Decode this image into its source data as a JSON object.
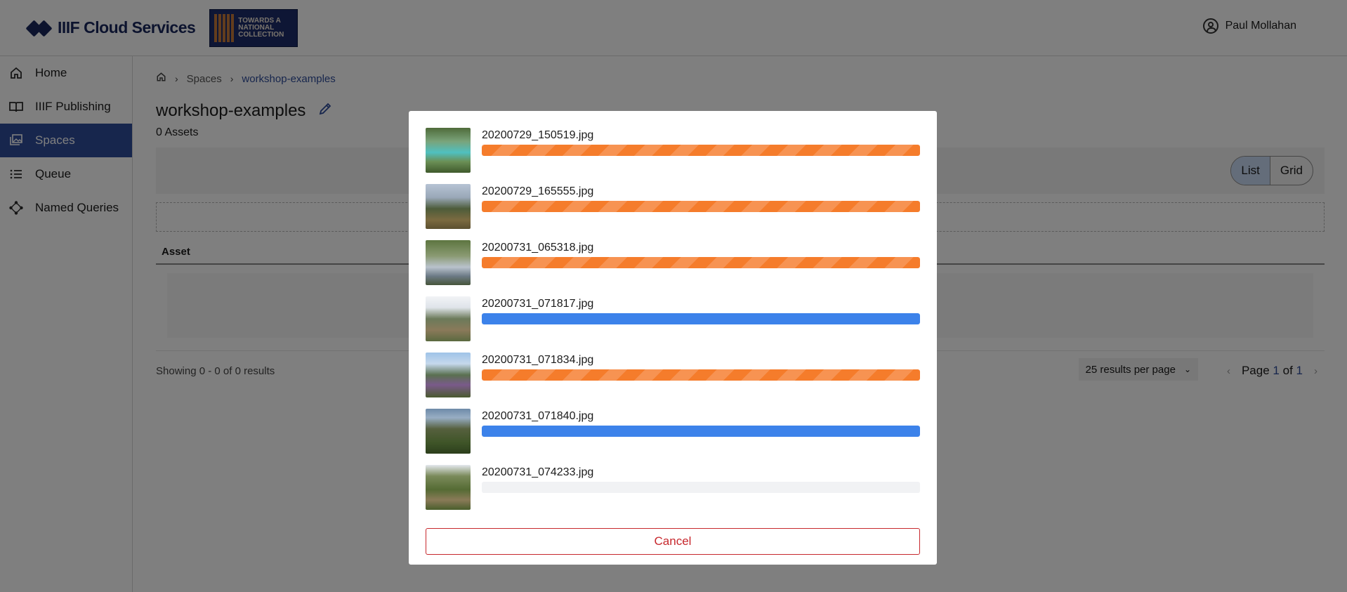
{
  "header": {
    "brand_name": "IIIF Cloud Services",
    "partner_logo_text": "TOWARDS A NATIONAL COLLECTION",
    "user_name": "Paul Mollahan"
  },
  "sidebar": {
    "items": [
      {
        "label": "Home",
        "icon": "home-icon"
      },
      {
        "label": "IIIF Publishing",
        "icon": "book-icon"
      },
      {
        "label": "Spaces",
        "icon": "spaces-icon",
        "active": true
      },
      {
        "label": "Queue",
        "icon": "list-icon"
      },
      {
        "label": "Named Queries",
        "icon": "network-icon"
      }
    ]
  },
  "breadcrumb": {
    "home": "home-icon",
    "items": [
      "Spaces",
      "workshop-examples"
    ]
  },
  "page": {
    "title": "workshop-examples",
    "asset_count": "0 Assets"
  },
  "toolbar": {
    "list_label": "List",
    "grid_label": "Grid"
  },
  "table": {
    "header": "Asset"
  },
  "results": {
    "showing": "Showing 0 - 0 of 0 results",
    "per_page": "25 results per page",
    "page_prefix": "Page",
    "page_current": "1",
    "page_of": "of",
    "page_total": "1"
  },
  "upload_modal": {
    "files": [
      {
        "name": "20200729_150519.jpg",
        "status": "uploading",
        "progress": 1.0
      },
      {
        "name": "20200729_165555.jpg",
        "status": "uploading",
        "progress": 1.0
      },
      {
        "name": "20200731_065318.jpg",
        "status": "uploading",
        "progress": 1.0
      },
      {
        "name": "20200731_071817.jpg",
        "status": "done",
        "progress": 1.0
      },
      {
        "name": "20200731_071834.jpg",
        "status": "uploading",
        "progress": 1.0
      },
      {
        "name": "20200731_071840.jpg",
        "status": "done",
        "progress": 1.0
      },
      {
        "name": "20200731_074233.jpg",
        "status": "pending",
        "progress": 0
      }
    ],
    "cancel_label": "Cancel"
  },
  "colors": {
    "brand": "#18275c",
    "accent": "#2e4c9a",
    "uploading": "#f57c2b",
    "done": "#3c82ea",
    "danger": "#c7282d"
  }
}
